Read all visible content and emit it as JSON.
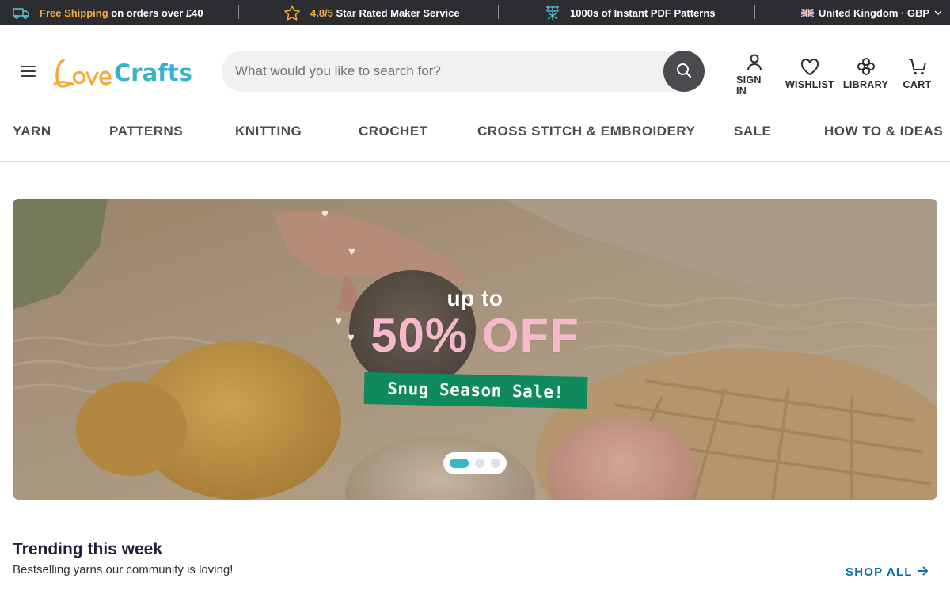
{
  "topbar": {
    "shipping": {
      "highlight": "Free Shipping",
      "text": "on orders over £40"
    },
    "rating": {
      "highlight": "4.8/5",
      "text": "Star Rated Maker Service"
    },
    "patterns": {
      "text": "1000s of Instant PDF Patterns"
    },
    "locale": {
      "text": "United Kingdom · GBP"
    }
  },
  "header": {
    "logo_alt": "LoveCrafts",
    "search": {
      "placeholder": "What would you like to search for?",
      "value": ""
    },
    "icons": [
      {
        "label": "SIGN IN",
        "icon": "user-icon"
      },
      {
        "label": "WISHLIST",
        "icon": "heart-icon"
      },
      {
        "label": "LIBRARY",
        "icon": "library-icon"
      },
      {
        "label": "CART",
        "icon": "cart-icon"
      }
    ]
  },
  "nav": {
    "categories": [
      "YARN",
      "PATTERNS",
      "KNITTING",
      "CROCHET",
      "CROSS STITCH & EMBROIDERY",
      "SALE",
      "HOW TO & IDEAS"
    ]
  },
  "hero": {
    "up_to": "up to",
    "headline": "50% OFF",
    "tag": "Snug Season Sale!",
    "slides": 3,
    "active_slide": 1
  },
  "trending": {
    "title": "Trending this week",
    "subtitle": "Bestselling yarns our community is loving!",
    "shop_all": "SHOP ALL"
  },
  "colors": {
    "topbar_bg": "#2b2d31",
    "topbar_highlight": "#f4a93b",
    "logo_orange": "#f7a833",
    "logo_teal": "#37b3c8",
    "sale_tag": "#0f8a5c",
    "headline_pink": "#f6b8cb",
    "link_blue": "#0b6fa8",
    "carousel_active": "#35b6cf"
  }
}
